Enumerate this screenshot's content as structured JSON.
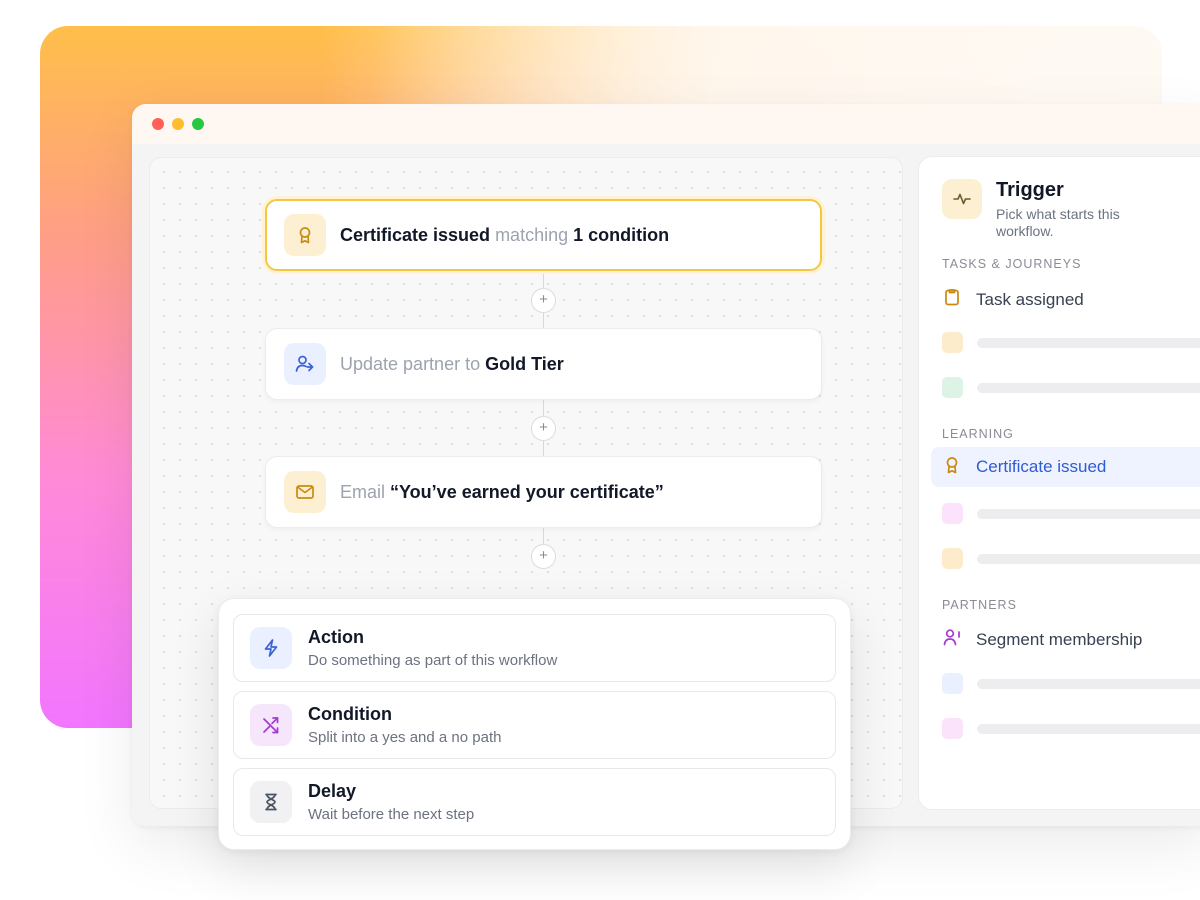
{
  "window": {
    "traffic_lights": [
      "#ff5f57",
      "#febc2e",
      "#28c840"
    ]
  },
  "workflow": {
    "nodes": [
      {
        "id": "trigger",
        "icon": "award-icon",
        "muted_prefix": "",
        "strong_a": "Certificate issued",
        "muted_mid": " matching ",
        "strong_b": "1 condition"
      },
      {
        "id": "update",
        "icon": "user-arrow-icon",
        "muted_prefix": "Update partner to ",
        "strong_a": "Gold Tier"
      },
      {
        "id": "email",
        "icon": "mail-icon",
        "muted_prefix": "Email ",
        "strong_a": "“You’ve earned your certificate”"
      }
    ],
    "add_step_label": "+"
  },
  "step_menu": {
    "items": [
      {
        "title": "Action",
        "description": "Do something as part of this workflow",
        "icon": "lightning-icon"
      },
      {
        "title": "Condition",
        "description": "Split into a yes and a no path",
        "icon": "shuffle-icon"
      },
      {
        "title": "Delay",
        "description": "Wait before the next step",
        "icon": "hourglass-icon"
      }
    ]
  },
  "trigger_panel": {
    "title": "Trigger",
    "subtitle": "Pick what starts this workflow.",
    "icon": "activity-icon",
    "sections": [
      {
        "label": "TASKS & JOURNEYS",
        "item": "Task assigned",
        "item_icon": "clipboard-icon",
        "placeholder_colors": [
          "#fdeccb",
          "#dcf3e6"
        ]
      },
      {
        "label": "LEARNING",
        "item": "Certificate issued",
        "item_icon": "award-icon",
        "placeholder_colors": [
          "#fbe3fb",
          "#fdeccb"
        ]
      },
      {
        "label": "PARTNERS",
        "item": "Segment membership",
        "item_icon": "user-segment-icon",
        "placeholder_colors": [
          "#eaf0ff",
          "#fbe3fb"
        ]
      }
    ]
  },
  "colors": {
    "selected_border": "#f5c646",
    "active_item": "#2f5bd3",
    "amber_tile": "#fdf0d2",
    "blue_tile": "#eaf0ff",
    "purple_tile": "#f6e6fb",
    "gray_tile": "#f1f1f4"
  }
}
